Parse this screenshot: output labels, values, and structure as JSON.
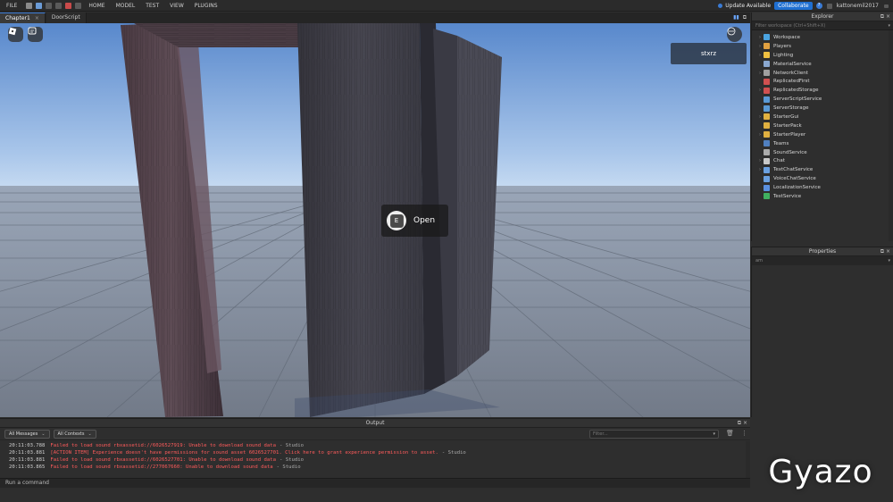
{
  "menu": {
    "file": "FILE",
    "items": [
      "HOME",
      "MODEL",
      "TEST",
      "VIEW",
      "PLUGINS"
    ]
  },
  "topright": {
    "update": "Update Available",
    "collaborate": "Collaborate",
    "help": "?",
    "username": "kattonemil2017"
  },
  "tabs": [
    {
      "label": "Chapter1",
      "active": true
    },
    {
      "label": "DoorScript",
      "active": false
    }
  ],
  "viewport": {
    "player_name": "stxrz",
    "prompt_key": "E",
    "prompt_action": "Open"
  },
  "explorer": {
    "title": "Explorer",
    "filter_placeholder": "Filter workspace (Ctrl+Shift+X)",
    "items": [
      {
        "label": "Workspace",
        "expandable": true,
        "icon_color": "#4aa3e0"
      },
      {
        "label": "Players",
        "expandable": true,
        "icon_color": "#e0a040"
      },
      {
        "label": "Lighting",
        "expandable": true,
        "icon_color": "#f0c040"
      },
      {
        "label": "MaterialService",
        "expandable": false,
        "icon_color": "#8aa8d0"
      },
      {
        "label": "NetworkClient",
        "expandable": true,
        "icon_color": "#a0a0a0"
      },
      {
        "label": "ReplicatedFirst",
        "expandable": false,
        "icon_color": "#d05050"
      },
      {
        "label": "ReplicatedStorage",
        "expandable": true,
        "icon_color": "#d05050"
      },
      {
        "label": "ServerScriptService",
        "expandable": false,
        "icon_color": "#5a9ad6"
      },
      {
        "label": "ServerStorage",
        "expandable": false,
        "icon_color": "#5a9ad6"
      },
      {
        "label": "StarterGui",
        "expandable": true,
        "icon_color": "#e0b040"
      },
      {
        "label": "StarterPack",
        "expandable": false,
        "icon_color": "#e0b040"
      },
      {
        "label": "StarterPlayer",
        "expandable": true,
        "icon_color": "#e0b040"
      },
      {
        "label": "Teams",
        "expandable": false,
        "icon_color": "#5080c0"
      },
      {
        "label": "SoundService",
        "expandable": false,
        "icon_color": "#aaaaaa"
      },
      {
        "label": "Chat",
        "expandable": true,
        "icon_color": "#c8c8c8"
      },
      {
        "label": "TextChatService",
        "expandable": true,
        "icon_color": "#6aa0e0"
      },
      {
        "label": "VoiceChatService",
        "expandable": false,
        "icon_color": "#6aa0e0"
      },
      {
        "label": "LocalizationService",
        "expandable": false,
        "icon_color": "#5a90e0"
      },
      {
        "label": "TestService",
        "expandable": false,
        "icon_color": "#40b060"
      }
    ]
  },
  "properties": {
    "title": "Properties",
    "filter_value": "am"
  },
  "output": {
    "title": "Output",
    "messages_filter": "All Messages",
    "contexts_filter": "All Contexts",
    "filter_placeholder": "Filter...",
    "lines": [
      {
        "time": "20:11:03.788",
        "message": "Failed to load sound rbxassetid://6026527919: Unable to download sound data",
        "source": "-  Studio"
      },
      {
        "time": "20:11:03.881",
        "message": "[ACTION ITEM] Experience doesn't have permissions for sound asset 6026527701. Click here to grant experience permission to asset.",
        "source": "-  Studio"
      },
      {
        "time": "20:11:03.881",
        "message": "Failed to load sound rbxassetid://6026527701: Unable to download sound data",
        "source": "-  Studio"
      },
      {
        "time": "20:11:03.865",
        "message": "Failed to load sound rbxassetid://277067660: Unable to download sound data",
        "source": "-  Studio"
      }
    ]
  },
  "command": {
    "placeholder": "Run a command"
  },
  "watermark": "Gyazo",
  "colors": {
    "accent": "#1f6fd1",
    "error": "#ff5b5b",
    "sky_top": "#5f8fd0",
    "sky_horizon": "#b9d3ef",
    "floor": "#7d8592"
  }
}
